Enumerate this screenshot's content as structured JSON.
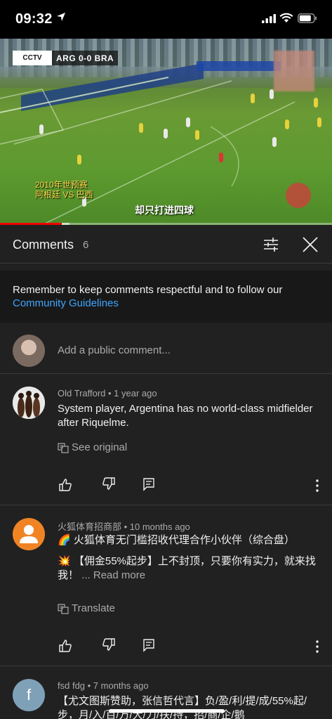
{
  "status_bar": {
    "time": "09:32"
  },
  "video": {
    "scoreboard": "ARG  0-0  BRA",
    "logo_text": "CCTV",
    "caption_left": [
      "2010年世预赛",
      "阿根廷 VS 巴西"
    ],
    "caption_main": "却只打进四球",
    "progress": 0.185,
    "buffered": 0.21
  },
  "panel": {
    "title": "Comments",
    "count": "6",
    "guidelines_text": "Remember to keep comments respectful and to follow our ",
    "guidelines_link": "Community Guidelines",
    "add_placeholder": "Add a public comment..."
  },
  "comments": [
    {
      "meta": "Old Trafford • 1 year ago",
      "body": "System player, Argentina has no world-class midfielder after Riquelme.",
      "translate": "See original"
    },
    {
      "meta": "火狐体育招商部 • 10 months ago",
      "line1_emoji": "🌈",
      "line1": "火狐体育无门槛招收代理合作小伙伴（综合盘）",
      "line2_emoji": "💥",
      "line2": "【佣金55%起步】上不封顶，只要你有实力，就来找我！",
      "read_more": "... Read more",
      "translate": "Translate"
    },
    {
      "meta": "fsd fdg • 7 months ago",
      "avatar_letter": "f",
      "body": "【尤文图斯赞助，张信哲代言】负/盈/利/提/成/55%起/步，月/入/百/万/大/力/扶/持，招/商/企/鹅"
    }
  ],
  "colors": {
    "panel_bg": "#212121",
    "link": "#3ea6ff",
    "progress": "#ee0000",
    "avatar_orange": "#f08425",
    "avatar_blue": "#7fa1b8"
  }
}
